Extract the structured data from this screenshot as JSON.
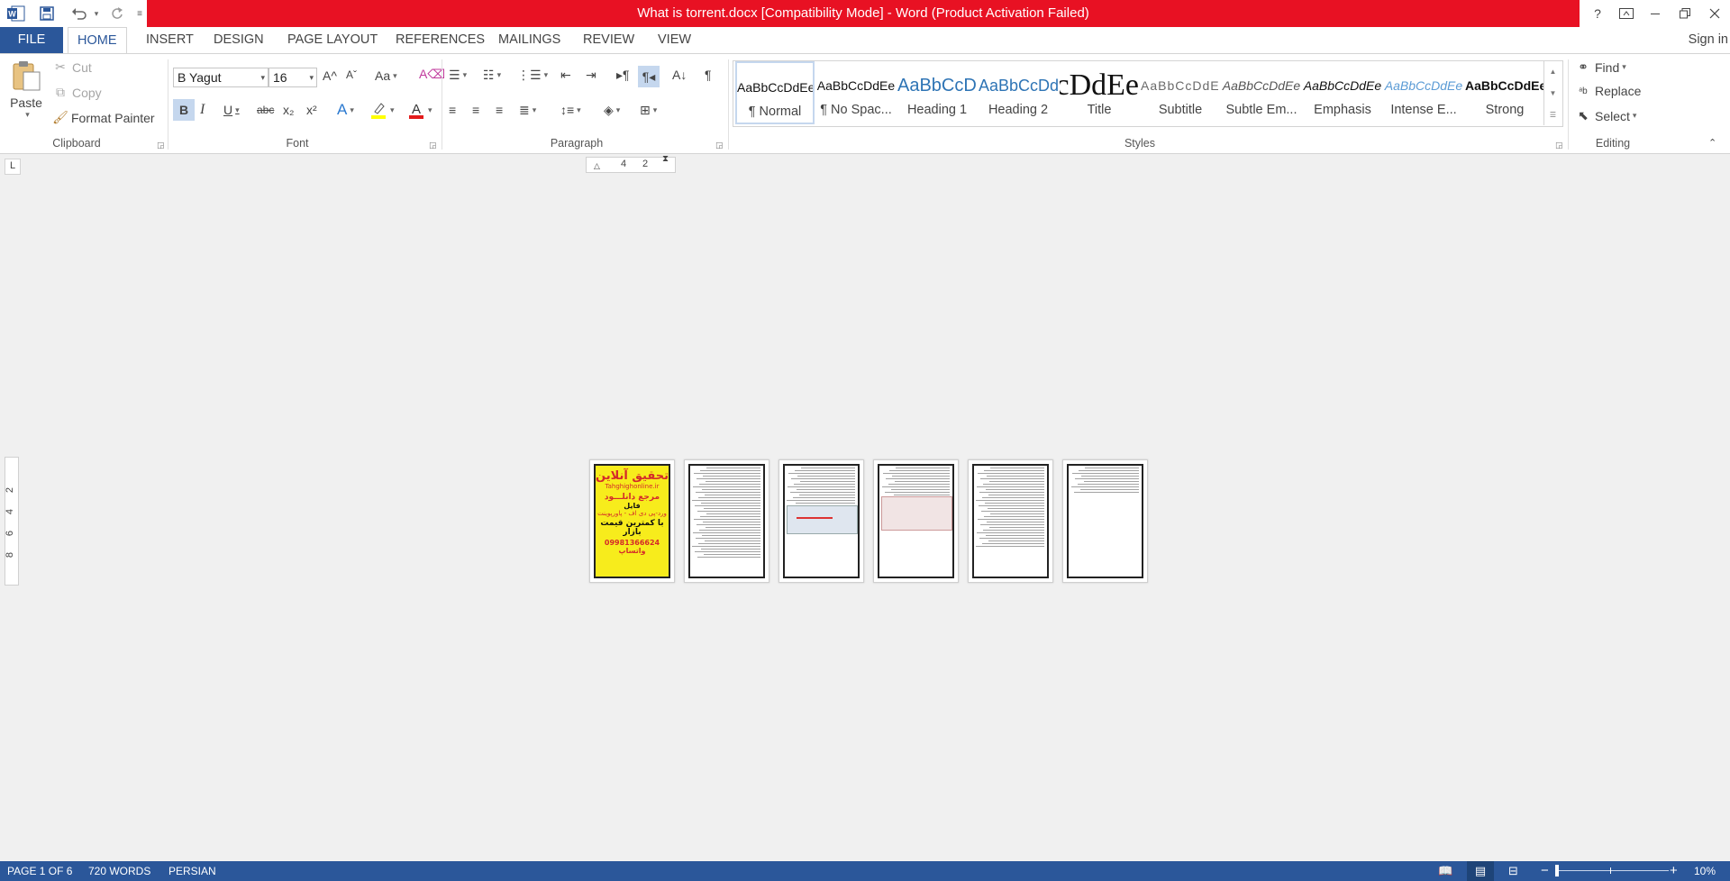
{
  "title_bar": {
    "title": "What is torrent.docx [Compatibility Mode] -  Word (Product Activation Failed)",
    "accent_color": "#e81123"
  },
  "window_controls": {
    "help": "?",
    "ribbon_display": "ribbon-display-icon",
    "minimize": "minimize-icon",
    "restore": "restore-icon",
    "close": "close-icon"
  },
  "tabs": [
    {
      "label": "FILE"
    },
    {
      "label": "HOME"
    },
    {
      "label": "INSERT"
    },
    {
      "label": "DESIGN"
    },
    {
      "label": "PAGE LAYOUT"
    },
    {
      "label": "REFERENCES"
    },
    {
      "label": "MAILINGS"
    },
    {
      "label": "REVIEW"
    },
    {
      "label": "VIEW"
    }
  ],
  "signin": "Sign in",
  "clipboard": {
    "paste": "Paste",
    "cut": "Cut",
    "copy": "Copy",
    "format_painter": "Format Painter",
    "label": "Clipboard"
  },
  "font": {
    "name": "B Yagut",
    "size": "16",
    "label": "Font",
    "bold": "B",
    "italic": "I",
    "underline": "U",
    "strike": "abc",
    "subscript": "x₂",
    "superscript": "x²",
    "grow": "A^",
    "shrink": "Aˇ",
    "change_case": "Aa"
  },
  "paragraph": {
    "label": "Paragraph"
  },
  "styles": {
    "label": "Styles",
    "items": [
      {
        "sample": "AaBbCcDdEe",
        "name": "¶ Normal"
      },
      {
        "sample": "AaBbCcDdEe",
        "name": "¶ No Spac..."
      },
      {
        "sample": "AaBbCcDdEe",
        "name": "Heading 1"
      },
      {
        "sample": "AaBbCcDdEe",
        "name": "Heading 2"
      },
      {
        "sample": "AaBbCcDdEe",
        "name": "Title"
      },
      {
        "sample": "AaBbCcDdEe",
        "name": "Subtitle"
      },
      {
        "sample": "AaBbCcDdEe",
        "name": "Subtle Em..."
      },
      {
        "sample": "AaBbCcDdEe",
        "name": "Emphasis"
      },
      {
        "sample": "AaBbCcDdEe",
        "name": "Intense E..."
      },
      {
        "sample": "AaBbCcDdEe",
        "name": "Strong"
      }
    ]
  },
  "editing": {
    "find": "Find",
    "replace": "Replace",
    "select": "Select",
    "label": "Editing"
  },
  "ruler": {
    "h_marks": [
      "4",
      "2"
    ],
    "v_marks": [
      "2",
      "4",
      "6",
      "8"
    ],
    "tab_selector": "L"
  },
  "pages": {
    "count": 6,
    "cover": {
      "line1": "تحقیق آنلاین",
      "line2": "Tahghighonline.ir",
      "line3": "مرجع دانلـــود",
      "line4": "فایل",
      "line5": "ورد-پی دی اف - پاورپوینت",
      "line6": "با کمترین قیمت بازار",
      "line7": "09981366624 واتساپ"
    }
  },
  "status": {
    "page": "PAGE 1 OF 6",
    "words": "720 WORDS",
    "language": "PERSIAN",
    "zoom": "10%",
    "zoom_minus": "−",
    "zoom_plus": "+"
  }
}
